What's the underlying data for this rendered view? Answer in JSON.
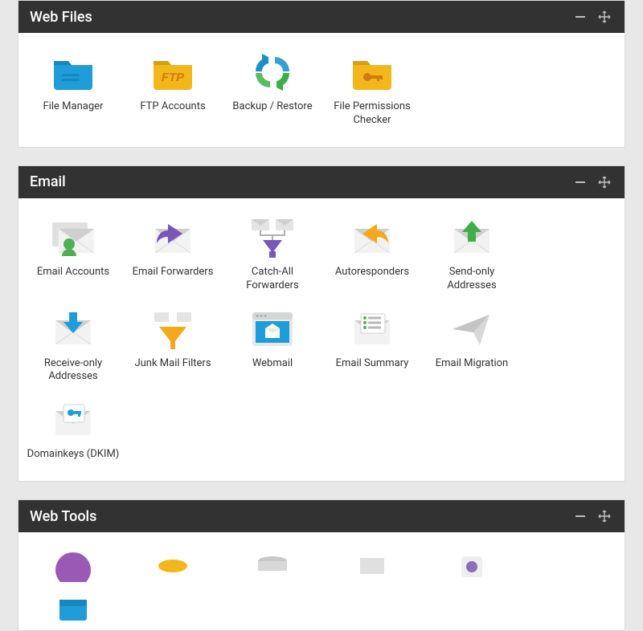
{
  "panels": [
    {
      "title": "Web Files",
      "items": [
        {
          "name": "file-manager",
          "label": "File Manager"
        },
        {
          "name": "ftp-accounts",
          "label": "FTP Accounts"
        },
        {
          "name": "backup-restore",
          "label": "Backup / Restore"
        },
        {
          "name": "file-permissions-checker",
          "label": "File Permissions Checker"
        }
      ]
    },
    {
      "title": "Email",
      "items": [
        {
          "name": "email-accounts",
          "label": "Email Accounts"
        },
        {
          "name": "email-forwarders",
          "label": "Email Forwarders"
        },
        {
          "name": "catch-all-forwarders",
          "label": "Catch-All Forwarders"
        },
        {
          "name": "autoresponders",
          "label": "Autoresponders"
        },
        {
          "name": "send-only-addresses",
          "label": "Send-only Addresses"
        },
        {
          "name": "receive-only-addresses",
          "label": "Receive-only Addresses"
        },
        {
          "name": "junk-mail-filters",
          "label": "Junk Mail Filters"
        },
        {
          "name": "webmail",
          "label": "Webmail"
        },
        {
          "name": "email-summary",
          "label": "Email Summary"
        },
        {
          "name": "email-migration",
          "label": "Email Migration"
        },
        {
          "name": "domainkeys-dkim",
          "label": "Domainkeys (DKIM)"
        }
      ]
    },
    {
      "title": "Web Tools",
      "items": [
        {
          "name": "web-tool-1",
          "label": ""
        },
        {
          "name": "web-tool-2",
          "label": ""
        },
        {
          "name": "web-tool-3",
          "label": ""
        },
        {
          "name": "web-tool-4",
          "label": ""
        },
        {
          "name": "web-tool-5",
          "label": ""
        },
        {
          "name": "web-tool-6",
          "label": ""
        }
      ]
    }
  ]
}
